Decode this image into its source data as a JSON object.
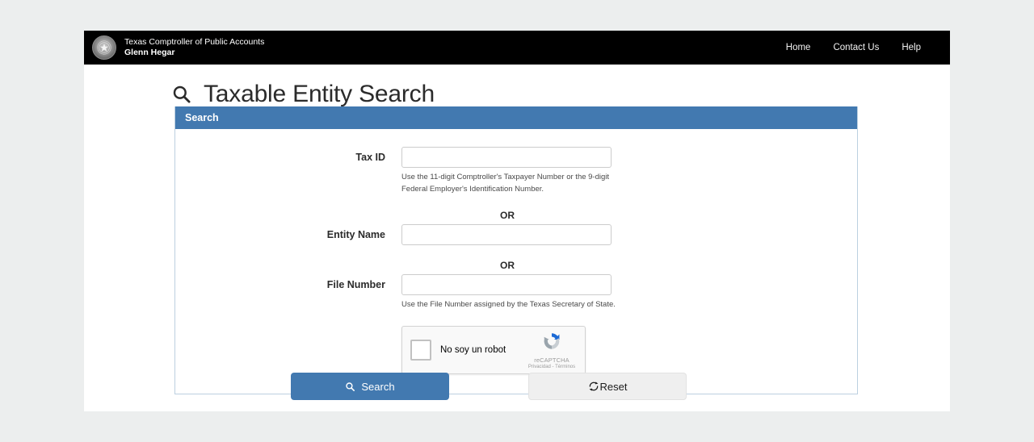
{
  "header": {
    "agency": "Texas Comptroller of Public Accounts",
    "official": "Glenn Hegar",
    "seal_icon": "texas-star-seal-icon",
    "nav": [
      {
        "label": "Home",
        "name": "nav-home"
      },
      {
        "label": "Contact Us",
        "name": "nav-contact-us"
      },
      {
        "label": "Help",
        "name": "nav-help"
      }
    ]
  },
  "page": {
    "title": "Taxable Entity Search",
    "title_icon": "search-icon"
  },
  "panel": {
    "heading": "Search",
    "accent_color": "#4279b0",
    "border_color": "#bcd0e0",
    "fields": {
      "tax_id": {
        "label": "Tax ID",
        "value": "",
        "placeholder": "",
        "hint": "Use the 11-digit Comptroller's Taxpayer Number or the 9-digit Federal Employer's Identification Number."
      },
      "entity_name": {
        "label": "Entity Name",
        "value": "",
        "placeholder": ""
      },
      "file_number": {
        "label": "File Number",
        "value": "",
        "placeholder": "",
        "hint": "Use the File Number assigned by the Texas Secretary of State."
      }
    },
    "separator_1": "OR",
    "separator_2": "OR",
    "captcha": {
      "label": "No soy un robot",
      "brand": "reCAPTCHA",
      "legal": "Privacidad - Términos",
      "checked": false,
      "logo_icon": "recaptcha-logo-icon"
    }
  },
  "actions": {
    "search": {
      "label": "Search",
      "icon": "search-icon",
      "color": "#4279b0"
    },
    "reset": {
      "label": "Reset",
      "icon": "refresh-icon",
      "color": "#efefef"
    }
  }
}
